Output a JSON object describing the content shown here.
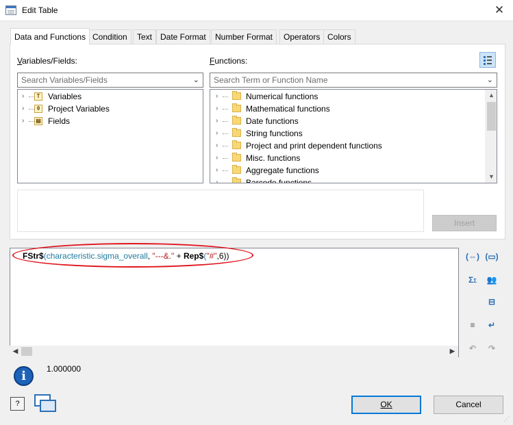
{
  "window": {
    "title": "Edit Table",
    "close_label": "✕"
  },
  "tabs": [
    {
      "label": "Data and Functions",
      "active": true
    },
    {
      "label": "Condition"
    },
    {
      "label": "Text"
    },
    {
      "label": "Date Format"
    },
    {
      "label": "Number Format"
    },
    {
      "label": "Operators"
    },
    {
      "label": "Colors"
    }
  ],
  "variables_panel": {
    "label_prefix": "V",
    "label_rest": "ariables/Fields:",
    "search_placeholder": "Search Variables/Fields",
    "items": [
      {
        "label": "Variables",
        "icon": "variable-icon",
        "glyph": "T"
      },
      {
        "label": "Project Variables",
        "icon": "project-variable-icon",
        "glyph": "θ"
      },
      {
        "label": "Fields",
        "icon": "field-icon",
        "glyph": "▤"
      }
    ]
  },
  "functions_panel": {
    "label_prefix": "F",
    "label_rest": "unctions:",
    "search_placeholder": "Search Term or Function Name",
    "items": [
      {
        "label": "Numerical functions"
      },
      {
        "label": "Mathematical functions"
      },
      {
        "label": "Date functions"
      },
      {
        "label": "String functions"
      },
      {
        "label": "Project and print dependent functions"
      },
      {
        "label": "Misc. functions"
      },
      {
        "label": "Aggregate functions"
      },
      {
        "label": "Barcode functions"
      }
    ]
  },
  "insert_button": {
    "label": "Insert",
    "enabled": false
  },
  "expression": {
    "fn1": "FStr$",
    "open1": "(",
    "var": "characteristic.sigma_overall",
    "comma1": ", ",
    "str1": "\"---&.\"",
    "plus": " + ",
    "fn2": "Rep$",
    "open2": "(",
    "str2": "\"#\"",
    "tail": ",6))"
  },
  "result": {
    "value": "1.000000"
  },
  "buttons": {
    "ok_label": "OK",
    "cancel_label": "Cancel",
    "help_label": "?"
  },
  "colors": {
    "highlight_ellipse": "#e0141e",
    "accent": "#0078d7",
    "info": "#1c62b9"
  }
}
